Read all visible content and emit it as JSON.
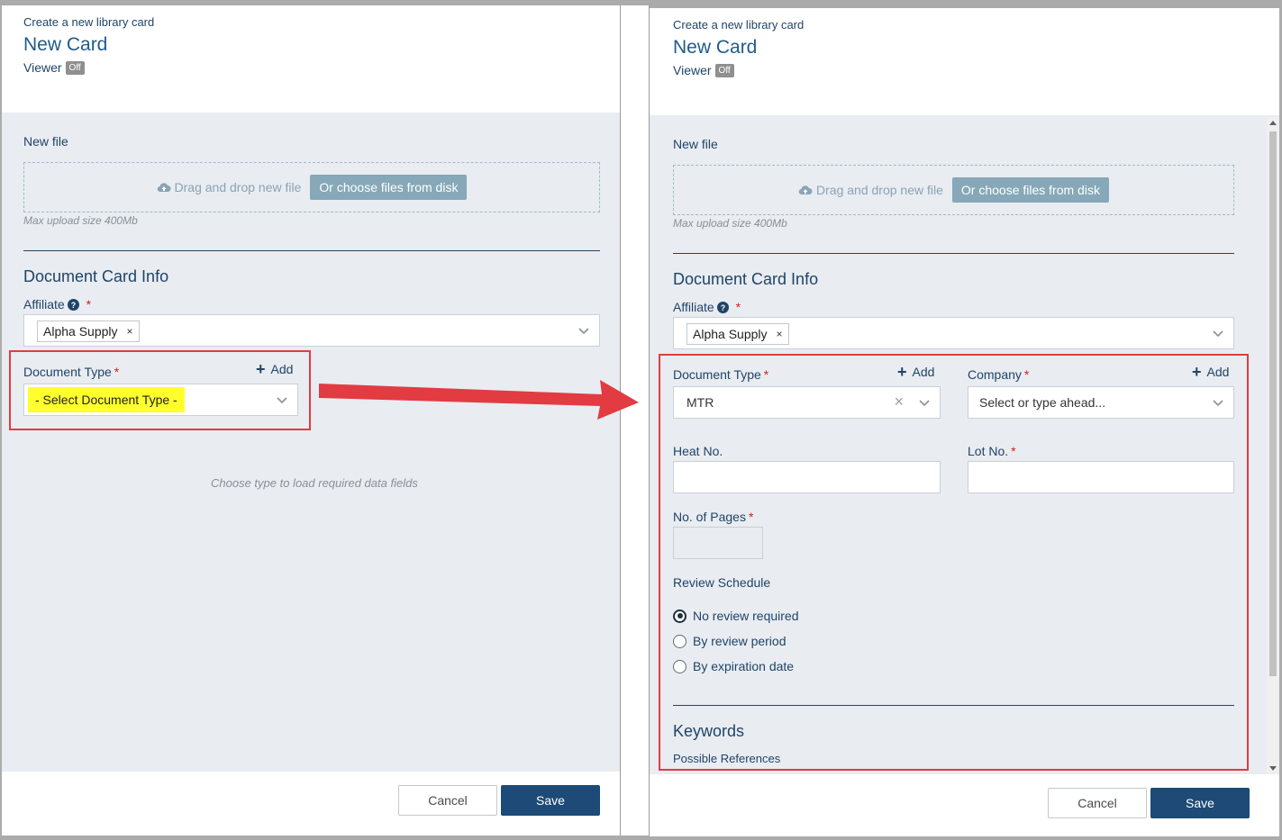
{
  "left": {
    "header": {
      "subtitle": "Create a new library card",
      "title": "New Card",
      "viewer_label": "Viewer",
      "viewer_state": "Off"
    },
    "upload": {
      "label": "New file",
      "drag_text": "Drag and drop new file",
      "choose_btn": "Or choose files from disk",
      "max_size": "Max upload size 400Mb"
    },
    "section_title": "Document Card Info",
    "affiliate": {
      "label": "Affiliate",
      "required": "*",
      "chip": "Alpha Supply",
      "chip_remove": "×"
    },
    "doc_type": {
      "label": "Document Type",
      "required": "*",
      "add": "Add",
      "placeholder": "- Select Document Type -"
    },
    "hint": "Choose type to load required data fields",
    "footer": {
      "cancel": "Cancel",
      "save": "Save"
    }
  },
  "right": {
    "header": {
      "subtitle": "Create a new library card",
      "title": "New Card",
      "viewer_label": "Viewer",
      "viewer_state": "Off"
    },
    "upload": {
      "label": "New file",
      "drag_text": "Drag and drop new file",
      "choose_btn": "Or choose files from disk",
      "max_size": "Max upload size 400Mb"
    },
    "section_title": "Document Card Info",
    "affiliate": {
      "label": "Affiliate",
      "required": "*",
      "chip": "Alpha Supply",
      "chip_remove": "×"
    },
    "doc_type": {
      "label": "Document Type",
      "required": "*",
      "add": "Add",
      "value": "MTR",
      "clear": "×"
    },
    "company": {
      "label": "Company",
      "required": "*",
      "add": "Add",
      "placeholder": "Select or type ahead..."
    },
    "heat_no": {
      "label": "Heat No."
    },
    "lot_no": {
      "label": "Lot No.",
      "required": "*"
    },
    "pages": {
      "label": "No. of Pages",
      "required": "*"
    },
    "review": {
      "label": "Review Schedule",
      "options": [
        "No review required",
        "By review period",
        "By expiration date"
      ],
      "selected": "No review required"
    },
    "keywords_title": "Keywords",
    "possible_refs": "Possible References",
    "footer": {
      "cancel": "Cancel",
      "save": "Save"
    }
  },
  "colors": {
    "accent": "#1d4a76",
    "annotation": "#e23b42",
    "highlight": "#ffff2e"
  }
}
